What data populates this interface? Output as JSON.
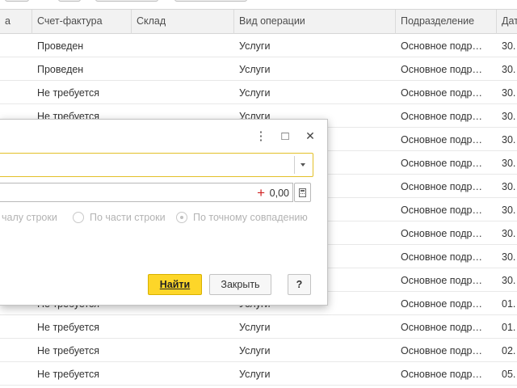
{
  "columns": [
    "а",
    "Счет-фактура",
    "Склад",
    "Вид операции",
    "Подразделение",
    "Дат"
  ],
  "rows": [
    {
      "invoice": "Проведен",
      "warehouse": "",
      "operation": "Услуги",
      "department": "Основное подр…",
      "date": "30."
    },
    {
      "invoice": "Проведен",
      "warehouse": "",
      "operation": "Услуги",
      "department": "Основное подр…",
      "date": "30."
    },
    {
      "invoice": "Не требуется",
      "warehouse": "",
      "operation": "Услуги",
      "department": "Основное подр…",
      "date": "30."
    },
    {
      "invoice": "Не требуется",
      "warehouse": "",
      "operation": "Услуги",
      "department": "Основное подр…",
      "date": "30."
    },
    {
      "invoice": "",
      "warehouse": "",
      "operation": "",
      "department": "Основное подр…",
      "date": "30."
    },
    {
      "invoice": "",
      "warehouse": "",
      "operation": "",
      "department": "Основное подр…",
      "date": "30."
    },
    {
      "invoice": "",
      "warehouse": "",
      "operation": "",
      "department": "Основное подр…",
      "date": "30."
    },
    {
      "invoice": "",
      "warehouse": "",
      "operation": "",
      "department": "Основное подр…",
      "date": "30."
    },
    {
      "invoice": "",
      "warehouse": "",
      "operation": "",
      "department": "Основное подр…",
      "date": "30."
    },
    {
      "invoice": "",
      "warehouse": "",
      "operation": "",
      "department": "Основное подр…",
      "date": "30."
    },
    {
      "invoice": "",
      "warehouse": "",
      "operation": "",
      "department": "Основное подр…",
      "date": "30."
    },
    {
      "invoice": "Не требуется",
      "warehouse": "",
      "operation": "Услуги",
      "department": "Основное подр…",
      "date": "01."
    },
    {
      "invoice": "Не требуется",
      "warehouse": "",
      "operation": "Услуги",
      "department": "Основное подр…",
      "date": "01."
    },
    {
      "invoice": "Не требуется",
      "warehouse": "",
      "operation": "Услуги",
      "department": "Основное подр…",
      "date": "02."
    },
    {
      "invoice": "Не требуется",
      "warehouse": "",
      "operation": "Услуги",
      "department": "Основное подр…",
      "date": "05."
    }
  ],
  "dialog": {
    "search_value": "",
    "number_value": "0,00",
    "plus_sign": "+",
    "radio_options": [
      "чалу строки",
      "По части строки",
      "По точному совпадению"
    ],
    "selected_option": "По точному совпадению",
    "find_label": "Найти",
    "close_label": "Закрыть",
    "help_label": "?",
    "more_icon": "⋮",
    "maximize_icon": "□",
    "close_icon": "✕"
  },
  "colors": {
    "accent": "#fdd629",
    "focus_border": "#e3c028",
    "header_bg": "#f2f2f2",
    "plus_red": "#d02020"
  }
}
